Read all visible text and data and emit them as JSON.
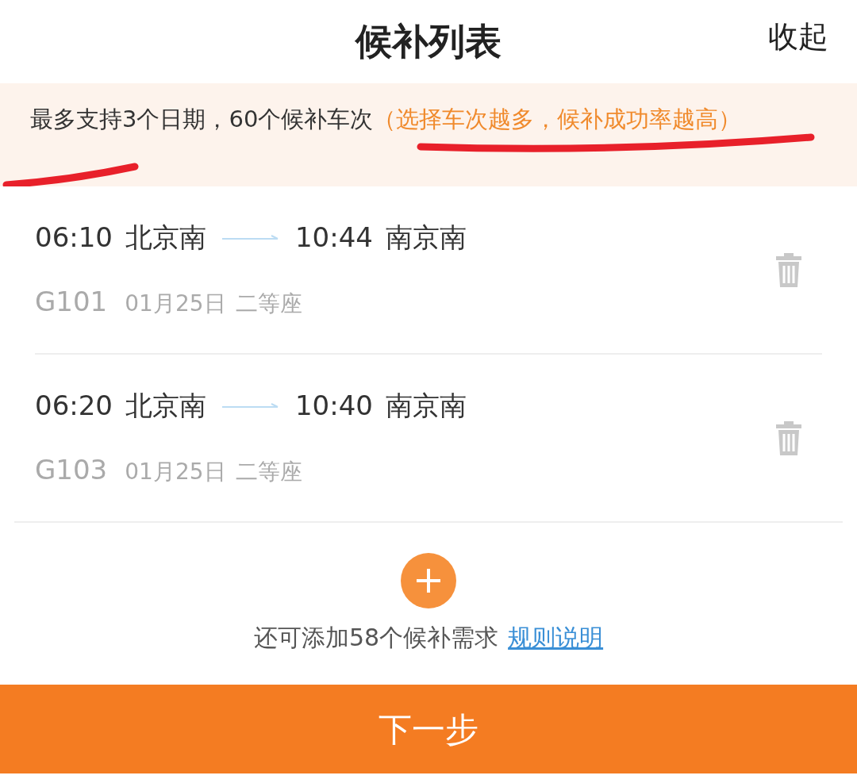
{
  "header": {
    "title": "候补列表",
    "collapse": "收起"
  },
  "notice": {
    "text": "最多支持3个日期，60个候补车次",
    "highlight": "（选择车次越多，候补成功率越高）"
  },
  "trains": [
    {
      "depart_time": "06:10",
      "from": "北京南",
      "arrive_time": "10:44",
      "to": "南京南",
      "train_no": "G101",
      "date": "01月25日",
      "seat": "二等座"
    },
    {
      "depart_time": "06:20",
      "from": "北京南",
      "arrive_time": "10:40",
      "to": "南京南",
      "train_no": "G103",
      "date": "01月25日",
      "seat": "二等座"
    }
  ],
  "add": {
    "text": "还可添加58个候补需求",
    "link": "规则说明"
  },
  "next_button": "下一步"
}
